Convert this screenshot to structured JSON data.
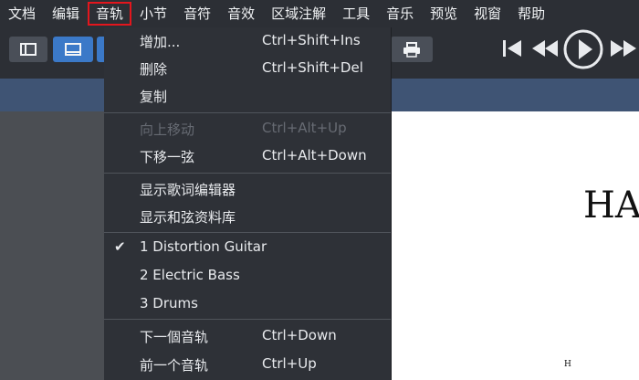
{
  "menubar": {
    "items": [
      "文档",
      "编辑",
      "音轨",
      "小节",
      "音符",
      "音效",
      "区域注解",
      "工具",
      "音乐",
      "预览",
      "视窗",
      "帮助"
    ],
    "active": "音轨"
  },
  "track_menu": {
    "items": [
      {
        "label": "增加...",
        "shortcut": "Ctrl+Shift+Ins",
        "enabled": true
      },
      {
        "label": "删除",
        "shortcut": "Ctrl+Shift+Del",
        "enabled": true
      },
      {
        "label": "复制",
        "shortcut": "",
        "enabled": true
      },
      {
        "label": "向上移动",
        "shortcut": "Ctrl+Alt+Up",
        "enabled": false
      },
      {
        "label": "下移一弦",
        "shortcut": "Ctrl+Alt+Down",
        "enabled": true
      },
      {
        "label": "显示歌词编辑器",
        "shortcut": "",
        "enabled": true
      },
      {
        "label": "显示和弦资料库",
        "shortcut": "",
        "enabled": true
      },
      {
        "label": "1 Distortion Guitar",
        "shortcut": "",
        "enabled": true,
        "checked": true
      },
      {
        "label": "2 Electric Bass",
        "shortcut": "",
        "enabled": true
      },
      {
        "label": "3 Drums",
        "shortcut": "",
        "enabled": true
      },
      {
        "label": "下一個音轨",
        "shortcut": "Ctrl+Down",
        "enabled": true
      },
      {
        "label": "前一个音轨",
        "shortcut": "Ctrl+Up",
        "enabled": true
      }
    ],
    "check_mark": "✔"
  },
  "score": {
    "title": "HA",
    "small_mark": "H"
  },
  "colors": {
    "menubar_bg": "#2c2f35",
    "active_outline": "#e3161d",
    "toggle_active": "#3b79c8",
    "strip": "#3f5474"
  },
  "icons": [
    "panel-left-icon",
    "panel-bottom-icon",
    "print-icon",
    "skip-start-icon",
    "rewind-icon",
    "play-icon",
    "fast-forward-icon"
  ]
}
